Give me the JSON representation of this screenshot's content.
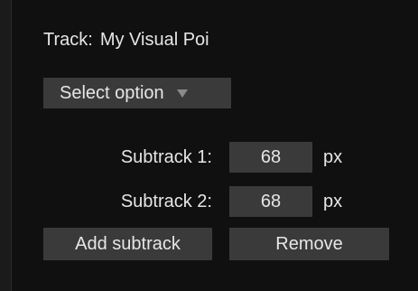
{
  "track": {
    "label": "Track:",
    "name": "My Visual Poi"
  },
  "select": {
    "label": "Select option",
    "icon": "caret-down-icon"
  },
  "subtracks": [
    {
      "label": "Subtrack 1:",
      "value": "68",
      "unit": "px"
    },
    {
      "label": "Subtrack 2:",
      "value": "68",
      "unit": "px"
    }
  ],
  "buttons": {
    "add": "Add subtrack",
    "remove": "Remove"
  }
}
